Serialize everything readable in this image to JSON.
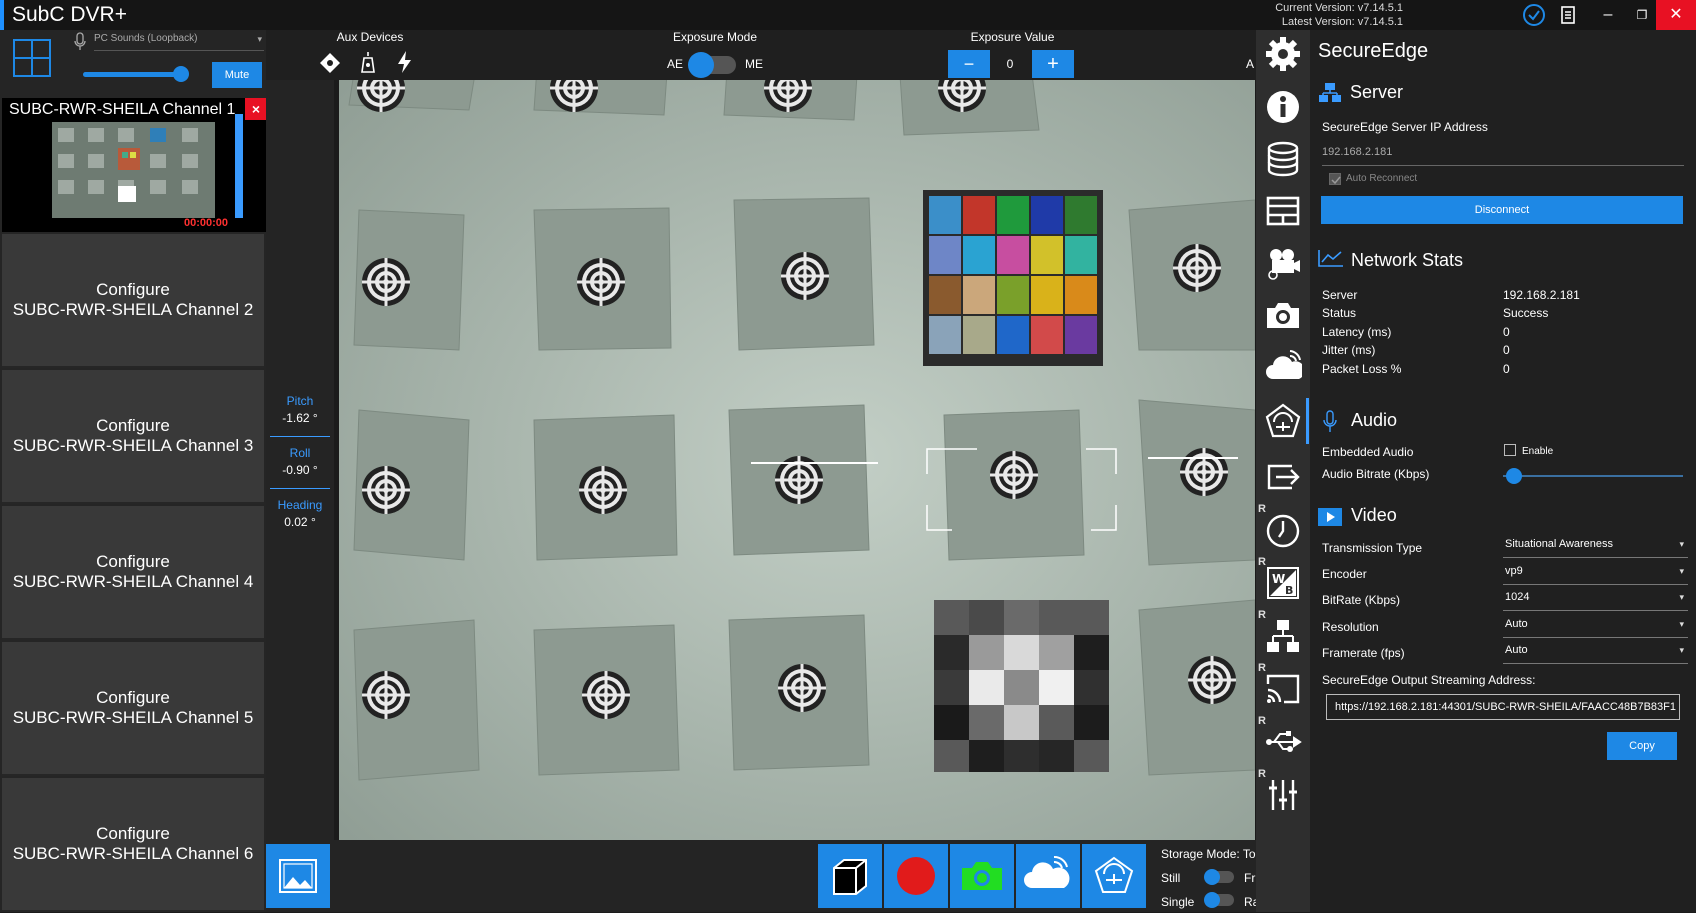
{
  "app": {
    "title": "SubC DVR+",
    "current_version": "Current Version: v7.14.5.1",
    "latest_version": "Latest Version: v7.14.5.1"
  },
  "audio_source": {
    "name": "PC Sounds (Loopback)",
    "mute_label": "Mute",
    "volume_level": 0.92
  },
  "preview": {
    "channel_title": "SUBC-RWR-SHEILA Channel 1",
    "timecode": "00:00:00"
  },
  "channels": [
    {
      "line1": "Configure",
      "line2": "SUBC-RWR-SHEILA Channel 2"
    },
    {
      "line1": "Configure",
      "line2": "SUBC-RWR-SHEILA Channel 3"
    },
    {
      "line1": "Configure",
      "line2": "SUBC-RWR-SHEILA Channel 4"
    },
    {
      "line1": "Configure",
      "line2": "SUBC-RWR-SHEILA Channel 5"
    },
    {
      "line1": "Configure",
      "line2": "SUBC-RWR-SHEILA Channel 6"
    }
  ],
  "pose": {
    "pitch_label": "Pitch",
    "pitch_value": "-1.62 °",
    "roll_label": "Roll",
    "roll_value": "-0.90 °",
    "heading_label": "Heading",
    "heading_value": "0.02 °"
  },
  "controls": {
    "aux_devices_label": "Aux Devices",
    "exposure_mode_label": "Exposure Mode",
    "ae_label": "AE",
    "me_label": "ME",
    "exposure_value_label": "Exposure Value",
    "exposure_value": "0",
    "minus": "−",
    "plus": "+",
    "clipped_letter": "A"
  },
  "storage": {
    "mode_label": "Storage Mode: Top",
    "still_label": "Still",
    "fr_label": "Fr",
    "single_label": "Single",
    "ra_label": "Ra"
  },
  "panel": {
    "title": "SecureEdge",
    "server_section": "Server",
    "ip_label": "SecureEdge Server IP Address",
    "ip_value": "192.168.2.181",
    "auto_reconnect": "Auto Reconnect",
    "disconnect": "Disconnect",
    "network_section": "Network Stats",
    "stats": [
      {
        "label": "Server",
        "value": "192.168.2.181"
      },
      {
        "label": "Status",
        "value": "Success"
      },
      {
        "label": "Latency (ms)",
        "value": "0"
      },
      {
        "label": "Jitter (ms)",
        "value": "0"
      },
      {
        "label": "Packet Loss %",
        "value": "0"
      }
    ],
    "audio_section": "Audio",
    "embedded_audio": "Embedded Audio",
    "enable": "Enable",
    "audio_bitrate": "Audio Bitrate (Kbps)",
    "audio_bitrate_level": 0.04,
    "video_section": "Video",
    "video_rows": [
      {
        "label": "Transmission Type",
        "value": "Situational Awareness"
      },
      {
        "label": "Encoder",
        "value": "vp9"
      },
      {
        "label": "BitRate (Kbps)",
        "value": "1024"
      },
      {
        "label": "Resolution",
        "value": "Auto"
      },
      {
        "label": "Framerate (fps)",
        "value": "Auto"
      }
    ],
    "stream_label": "SecureEdge Output Streaming Address:",
    "stream_url": "https://192.168.2.181:44301/SUBC-RWR-SHEILA/FAACC48B7B83F1",
    "copy": "Copy"
  },
  "colors": {
    "accent": "#1e88e5",
    "record": "#e11b1b",
    "snapshot_green": "#22dd22",
    "close_red": "#e81123"
  }
}
